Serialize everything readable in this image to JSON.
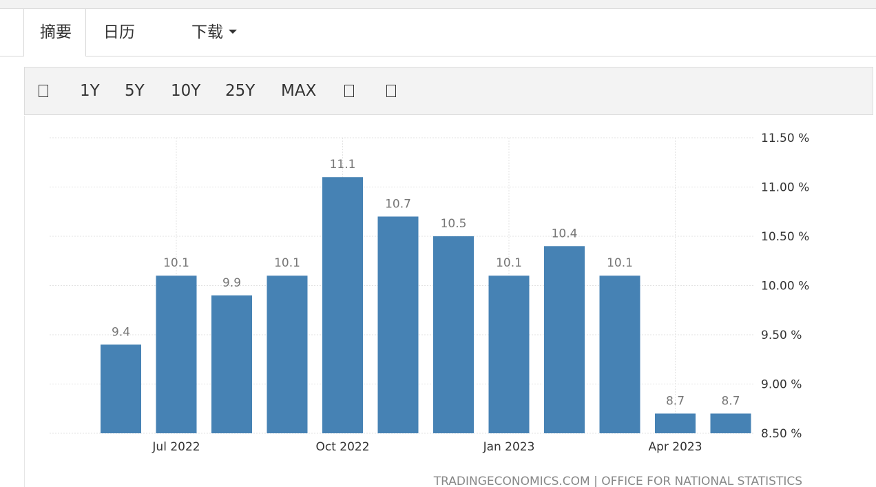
{
  "tabs": [
    {
      "label": "摘要",
      "active": true
    },
    {
      "label": "日历",
      "active": false
    },
    {
      "label": "下载",
      "active": false
    }
  ],
  "toolbar": {
    "buttons": [
      {
        "label": "",
        "icon": "calendar-icon"
      },
      {
        "label": "1Y"
      },
      {
        "label": "5Y"
      },
      {
        "label": "10Y"
      },
      {
        "label": "25Y"
      },
      {
        "label": "MAX"
      },
      {
        "label": "",
        "icon": "chart-type-icon"
      },
      {
        "label": "",
        "icon": "settings-icon"
      }
    ]
  },
  "chart_data": {
    "type": "bar",
    "title": "",
    "xlabel": "",
    "ylabel": "",
    "categories": [
      "2022-06",
      "2022-07",
      "2022-08",
      "2022-09",
      "2022-10",
      "2022-11",
      "2022-12",
      "2023-01",
      "2023-02",
      "2023-03",
      "2023-04",
      "2023-05"
    ],
    "values": [
      9.4,
      10.1,
      9.9,
      10.1,
      11.1,
      10.7,
      10.5,
      10.1,
      10.4,
      10.1,
      8.7,
      8.7
    ],
    "data_labels": [
      "9.4",
      "10.1",
      "9.9",
      "10.1",
      "11.1",
      "10.7",
      "10.5",
      "10.1",
      "10.4",
      "10.1",
      "8.7",
      "8.7"
    ],
    "x_tick_labels": [
      {
        "label": "Jul 2022",
        "at": "2022-07"
      },
      {
        "label": "Oct 2022",
        "at": "2022-10"
      },
      {
        "label": "Jan 2023",
        "at": "2023-01"
      },
      {
        "label": "Apr 2023",
        "at": "2023-04"
      }
    ],
    "y_ticks": [
      8.5,
      9.0,
      9.5,
      10.0,
      10.5,
      11.0,
      11.5
    ],
    "y_tick_labels": [
      "8.50 %",
      "9.00 %",
      "9.50 %",
      "10.00 %",
      "10.50 %",
      "11.00 %",
      "11.50 %"
    ],
    "ylim": [
      8.5,
      11.5
    ],
    "y_axis_side": "right",
    "grid": true,
    "bar_color": "#4682b4",
    "source": "TRADINGECONOMICS.COM | OFFICE FOR NATIONAL STATISTICS"
  }
}
